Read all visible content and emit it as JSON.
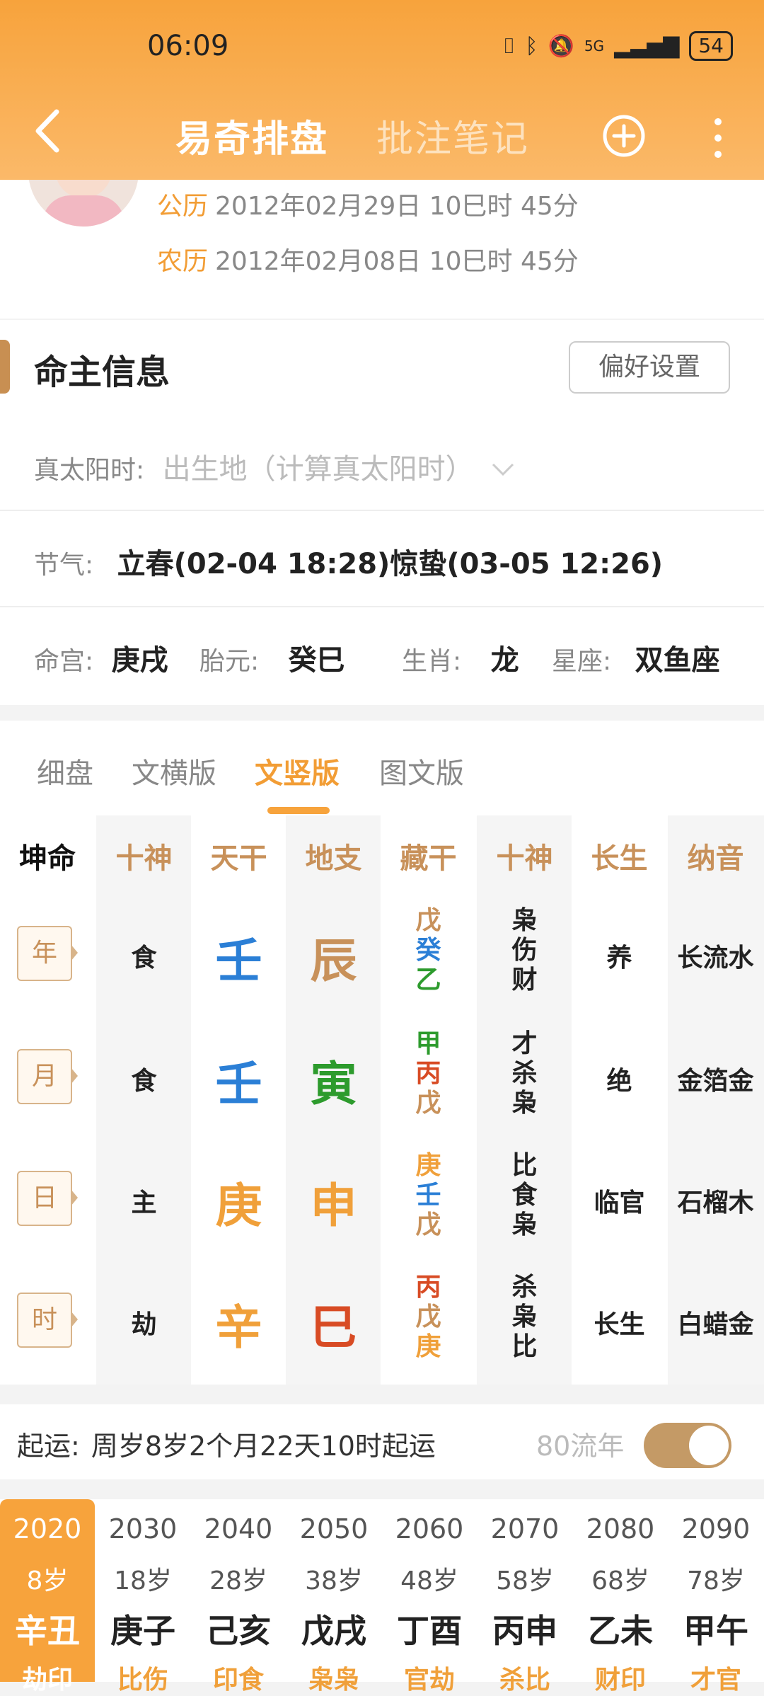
{
  "status": {
    "time": "06:09",
    "battery": "54",
    "network": "5G"
  },
  "nav": {
    "tab_active": "易奇排盘",
    "tab_notes": "批注笔记"
  },
  "profile": {
    "solar_label": "公历",
    "solar_value": "2012年02月29日 10巳时 45分",
    "lunar_label": "农历",
    "lunar_value": "2012年02月08日 10巳时 45分"
  },
  "section": {
    "title": "命主信息",
    "pref_button": "偏好设置"
  },
  "true_solar": {
    "label": "真太阳时:",
    "value": "出生地（计算真太阳时）"
  },
  "jieqi": {
    "label": "节气:",
    "value": "立春(02-04 18:28)惊蛰(03-05 12:26)"
  },
  "palace": {
    "minggong_label": "命宫:",
    "minggong": "庚戌",
    "taiyuan_label": "胎元:",
    "taiyuan": "癸巳",
    "shengxiao_label": "生肖:",
    "shengxiao": "龙",
    "xingzuo_label": "星座:",
    "xingzuo": "双鱼座"
  },
  "view_tabs": [
    "细盘",
    "文横版",
    "文竖版",
    "图文版"
  ],
  "view_active": "文竖版",
  "table": {
    "headers": [
      "坤命",
      "十神",
      "天干",
      "地支",
      "藏干",
      "十神",
      "长生",
      "纳音"
    ],
    "rows": [
      {
        "pillar": "年",
        "shishen": "食",
        "gan": "壬",
        "zhi": "辰",
        "canggan": [
          "戊",
          "癸",
          "乙"
        ],
        "canggan_shishen": [
          "枭",
          "伤",
          "财"
        ],
        "changsheng": "养",
        "nayin": "长流水"
      },
      {
        "pillar": "月",
        "shishen": "食",
        "gan": "壬",
        "zhi": "寅",
        "canggan": [
          "甲",
          "丙",
          "戊"
        ],
        "canggan_shishen": [
          "才",
          "杀",
          "枭"
        ],
        "changsheng": "绝",
        "nayin": "金箔金"
      },
      {
        "pillar": "日",
        "shishen": "主",
        "gan": "庚",
        "zhi": "申",
        "canggan": [
          "庚",
          "壬",
          "戊"
        ],
        "canggan_shishen": [
          "比",
          "食",
          "枭"
        ],
        "changsheng": "临官",
        "nayin": "石榴木"
      },
      {
        "pillar": "时",
        "shishen": "劫",
        "gan": "辛",
        "zhi": "巳",
        "canggan": [
          "丙",
          "戊",
          "庚"
        ],
        "canggan_shishen": [
          "杀",
          "枭",
          "比"
        ],
        "changsheng": "长生",
        "nayin": "白蜡金"
      }
    ]
  },
  "colors": {
    "accent": "#f7a33c",
    "brown": "#c8915a",
    "blue": "#2b7fd6",
    "green": "#2d9b2d",
    "red": "#d84b24"
  },
  "qiyun": {
    "label": "起运:",
    "value": "周岁8岁2个月22天10时起运",
    "liunian": "80流年"
  },
  "dayun": [
    {
      "year": "2020",
      "age": "8岁",
      "gz": "辛丑",
      "ss": "劫印"
    },
    {
      "year": "2030",
      "age": "18岁",
      "gz": "庚子",
      "ss": "比伤"
    },
    {
      "year": "2040",
      "age": "28岁",
      "gz": "己亥",
      "ss": "印食"
    },
    {
      "year": "2050",
      "age": "38岁",
      "gz": "戊戌",
      "ss": "枭枭"
    },
    {
      "year": "2060",
      "age": "48岁",
      "gz": "丁酉",
      "ss": "官劫"
    },
    {
      "year": "2070",
      "age": "58岁",
      "gz": "丙申",
      "ss": "杀比"
    },
    {
      "year": "2080",
      "age": "68岁",
      "gz": "乙未",
      "ss": "财印"
    },
    {
      "year": "2090",
      "age": "78岁",
      "gz": "甲午",
      "ss": "才官"
    }
  ]
}
